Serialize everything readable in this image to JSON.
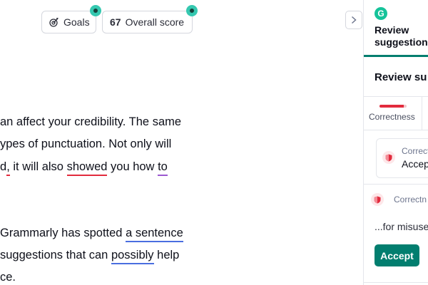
{
  "header": {
    "goals_label": "Goals",
    "goals_icon": "goals-target-icon",
    "score_value": "67",
    "score_label": "Overall score",
    "collapse_icon": "chevron-right-icon"
  },
  "document": {
    "lines": [
      [
        "an affect your credibility. The same"
      ],
      [
        "ypes of punctuation. Not only will"
      ],
      [
        "d",
        ",",
        " it will also ",
        "showed",
        " you how ",
        "to"
      ],
      [
        "Grammarly has spotted ",
        "a sentence"
      ],
      [
        " suggestions that can ",
        "possibly",
        " help"
      ],
      [
        "ce."
      ]
    ]
  },
  "sidebar": {
    "logo_letter": "G",
    "header_title_1": "Review",
    "header_title_2": "suggestions",
    "section_title": "Review su",
    "tab_label": "Correctness",
    "tab_progress": 0.9,
    "card1": {
      "category": "Correct",
      "action": "Accep"
    },
    "card2": {
      "category": "Correctn",
      "description": "...for misuse",
      "accept_label": "Accept"
    },
    "shield_icon": "shield-icon"
  },
  "colors": {
    "accent": "#027e6f",
    "score_dot": "#35c8b0",
    "error_underline": "#e22b3d",
    "clarity_underline": "#4a6ee0",
    "engagement_underline": "#9b59d0"
  }
}
